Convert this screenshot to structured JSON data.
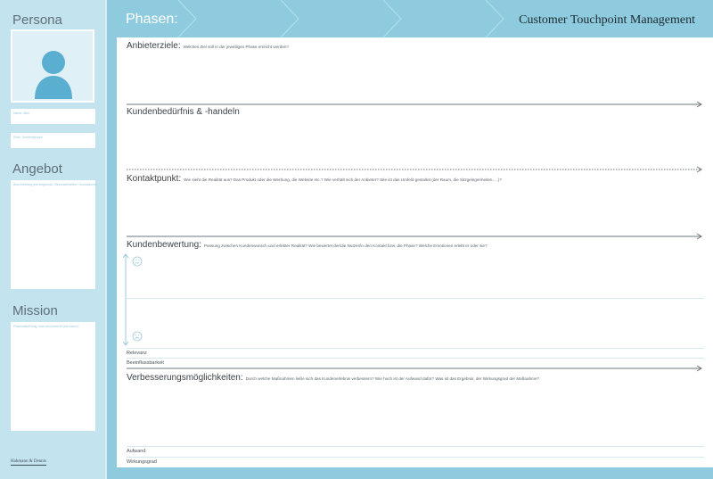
{
  "app": {
    "title": "Customer Touchpoint Management",
    "phases_label": "Phasen:"
  },
  "sidebar": {
    "persona_heading": "Persona",
    "name_placeholder": "Name, Alter",
    "role_placeholder": "Rolle, Kundengruppe",
    "angebot_heading": "Angebot",
    "angebot_placeholder": "Beschreibung des Angebots / Besonderheiten / Innovationen",
    "mission_heading": "Mission",
    "mission_placeholder": "Potenziale/Erfolg, was wird erreicht (bis wann)?",
    "brand": "Hahmann & Dennis"
  },
  "sections": {
    "anbieterziele": {
      "title": "Anbieterziele:",
      "desc": "Welches Ziel soll in der jeweiligen Phase erreicht werden?"
    },
    "kundenbeduerfnis": {
      "title": "Kundenbedürfnis & -handeln",
      "desc": ""
    },
    "kontaktpunkt": {
      "title": "Kontaktpunkt:",
      "desc": "Wie sieht die Realität aus? Das Produkt oder die Werbung, die Website etc.? Wie verhält sich der Anbieter? Wie ist das Umfeld gestaltet (der Raum, die Sitzgelegenheiten, ...)?"
    },
    "kundenbewertung": {
      "title": "Kundenbewertung:",
      "desc": "Passung zwischen Kundenwunsch und erlebter Realität? Wie bewertet der/die Nutzer/in den Kontakt bzw. die Phase? Welche Emotionen erlebt er oder sie?"
    },
    "verbesserung": {
      "title": "Verbesserungsmöglichkeiten:",
      "desc": "Durch welche Maßnahmen ließe sich das Kundenerlebnis verbessern? Wie hoch ist der Aufwand dafür? Was ist das Ergebnis, der Wirkungsgrad der Maßnahme?"
    }
  },
  "rows": {
    "relevanz": "Relevanz",
    "beeinflussbarkeit": "Beeinflussbarkeit",
    "aufwand": "Aufwand",
    "wirkungsgrad": "Wirkungsgrad"
  },
  "icons": {
    "happy": "happy-face-icon",
    "sad": "sad-face-icon",
    "avatar": "person-avatar-icon"
  },
  "colors": {
    "sidebar": "#c3e3ef",
    "header": "#8fcbdf",
    "accent": "#5aaed0"
  }
}
